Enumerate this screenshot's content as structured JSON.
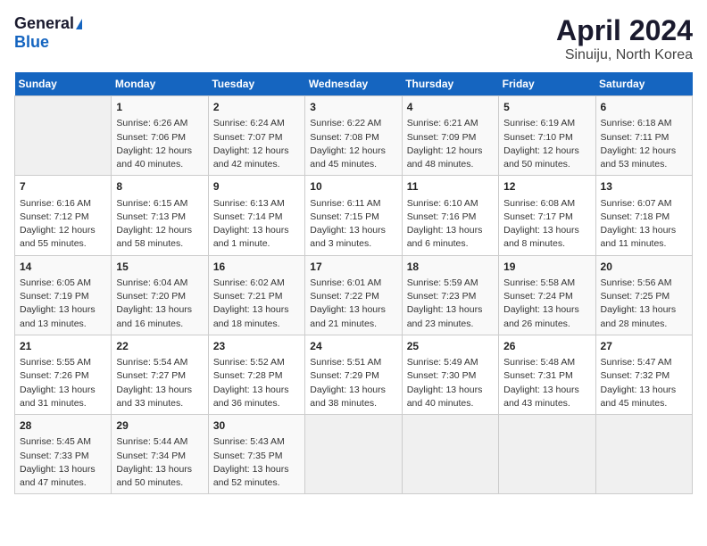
{
  "logo": {
    "general": "General",
    "blue": "Blue"
  },
  "title": "April 2024",
  "location": "Sinuiju, North Korea",
  "days_header": [
    "Sunday",
    "Monday",
    "Tuesday",
    "Wednesday",
    "Thursday",
    "Friday",
    "Saturday"
  ],
  "weeks": [
    [
      {
        "day": "",
        "info": ""
      },
      {
        "day": "1",
        "info": "Sunrise: 6:26 AM\nSunset: 7:06 PM\nDaylight: 12 hours\nand 40 minutes."
      },
      {
        "day": "2",
        "info": "Sunrise: 6:24 AM\nSunset: 7:07 PM\nDaylight: 12 hours\nand 42 minutes."
      },
      {
        "day": "3",
        "info": "Sunrise: 6:22 AM\nSunset: 7:08 PM\nDaylight: 12 hours\nand 45 minutes."
      },
      {
        "day": "4",
        "info": "Sunrise: 6:21 AM\nSunset: 7:09 PM\nDaylight: 12 hours\nand 48 minutes."
      },
      {
        "day": "5",
        "info": "Sunrise: 6:19 AM\nSunset: 7:10 PM\nDaylight: 12 hours\nand 50 minutes."
      },
      {
        "day": "6",
        "info": "Sunrise: 6:18 AM\nSunset: 7:11 PM\nDaylight: 12 hours\nand 53 minutes."
      }
    ],
    [
      {
        "day": "7",
        "info": "Sunrise: 6:16 AM\nSunset: 7:12 PM\nDaylight: 12 hours\nand 55 minutes."
      },
      {
        "day": "8",
        "info": "Sunrise: 6:15 AM\nSunset: 7:13 PM\nDaylight: 12 hours\nand 58 minutes."
      },
      {
        "day": "9",
        "info": "Sunrise: 6:13 AM\nSunset: 7:14 PM\nDaylight: 13 hours\nand 1 minute."
      },
      {
        "day": "10",
        "info": "Sunrise: 6:11 AM\nSunset: 7:15 PM\nDaylight: 13 hours\nand 3 minutes."
      },
      {
        "day": "11",
        "info": "Sunrise: 6:10 AM\nSunset: 7:16 PM\nDaylight: 13 hours\nand 6 minutes."
      },
      {
        "day": "12",
        "info": "Sunrise: 6:08 AM\nSunset: 7:17 PM\nDaylight: 13 hours\nand 8 minutes."
      },
      {
        "day": "13",
        "info": "Sunrise: 6:07 AM\nSunset: 7:18 PM\nDaylight: 13 hours\nand 11 minutes."
      }
    ],
    [
      {
        "day": "14",
        "info": "Sunrise: 6:05 AM\nSunset: 7:19 PM\nDaylight: 13 hours\nand 13 minutes."
      },
      {
        "day": "15",
        "info": "Sunrise: 6:04 AM\nSunset: 7:20 PM\nDaylight: 13 hours\nand 16 minutes."
      },
      {
        "day": "16",
        "info": "Sunrise: 6:02 AM\nSunset: 7:21 PM\nDaylight: 13 hours\nand 18 minutes."
      },
      {
        "day": "17",
        "info": "Sunrise: 6:01 AM\nSunset: 7:22 PM\nDaylight: 13 hours\nand 21 minutes."
      },
      {
        "day": "18",
        "info": "Sunrise: 5:59 AM\nSunset: 7:23 PM\nDaylight: 13 hours\nand 23 minutes."
      },
      {
        "day": "19",
        "info": "Sunrise: 5:58 AM\nSunset: 7:24 PM\nDaylight: 13 hours\nand 26 minutes."
      },
      {
        "day": "20",
        "info": "Sunrise: 5:56 AM\nSunset: 7:25 PM\nDaylight: 13 hours\nand 28 minutes."
      }
    ],
    [
      {
        "day": "21",
        "info": "Sunrise: 5:55 AM\nSunset: 7:26 PM\nDaylight: 13 hours\nand 31 minutes."
      },
      {
        "day": "22",
        "info": "Sunrise: 5:54 AM\nSunset: 7:27 PM\nDaylight: 13 hours\nand 33 minutes."
      },
      {
        "day": "23",
        "info": "Sunrise: 5:52 AM\nSunset: 7:28 PM\nDaylight: 13 hours\nand 36 minutes."
      },
      {
        "day": "24",
        "info": "Sunrise: 5:51 AM\nSunset: 7:29 PM\nDaylight: 13 hours\nand 38 minutes."
      },
      {
        "day": "25",
        "info": "Sunrise: 5:49 AM\nSunset: 7:30 PM\nDaylight: 13 hours\nand 40 minutes."
      },
      {
        "day": "26",
        "info": "Sunrise: 5:48 AM\nSunset: 7:31 PM\nDaylight: 13 hours\nand 43 minutes."
      },
      {
        "day": "27",
        "info": "Sunrise: 5:47 AM\nSunset: 7:32 PM\nDaylight: 13 hours\nand 45 minutes."
      }
    ],
    [
      {
        "day": "28",
        "info": "Sunrise: 5:45 AM\nSunset: 7:33 PM\nDaylight: 13 hours\nand 47 minutes."
      },
      {
        "day": "29",
        "info": "Sunrise: 5:44 AM\nSunset: 7:34 PM\nDaylight: 13 hours\nand 50 minutes."
      },
      {
        "day": "30",
        "info": "Sunrise: 5:43 AM\nSunset: 7:35 PM\nDaylight: 13 hours\nand 52 minutes."
      },
      {
        "day": "",
        "info": ""
      },
      {
        "day": "",
        "info": ""
      },
      {
        "day": "",
        "info": ""
      },
      {
        "day": "",
        "info": ""
      }
    ]
  ]
}
